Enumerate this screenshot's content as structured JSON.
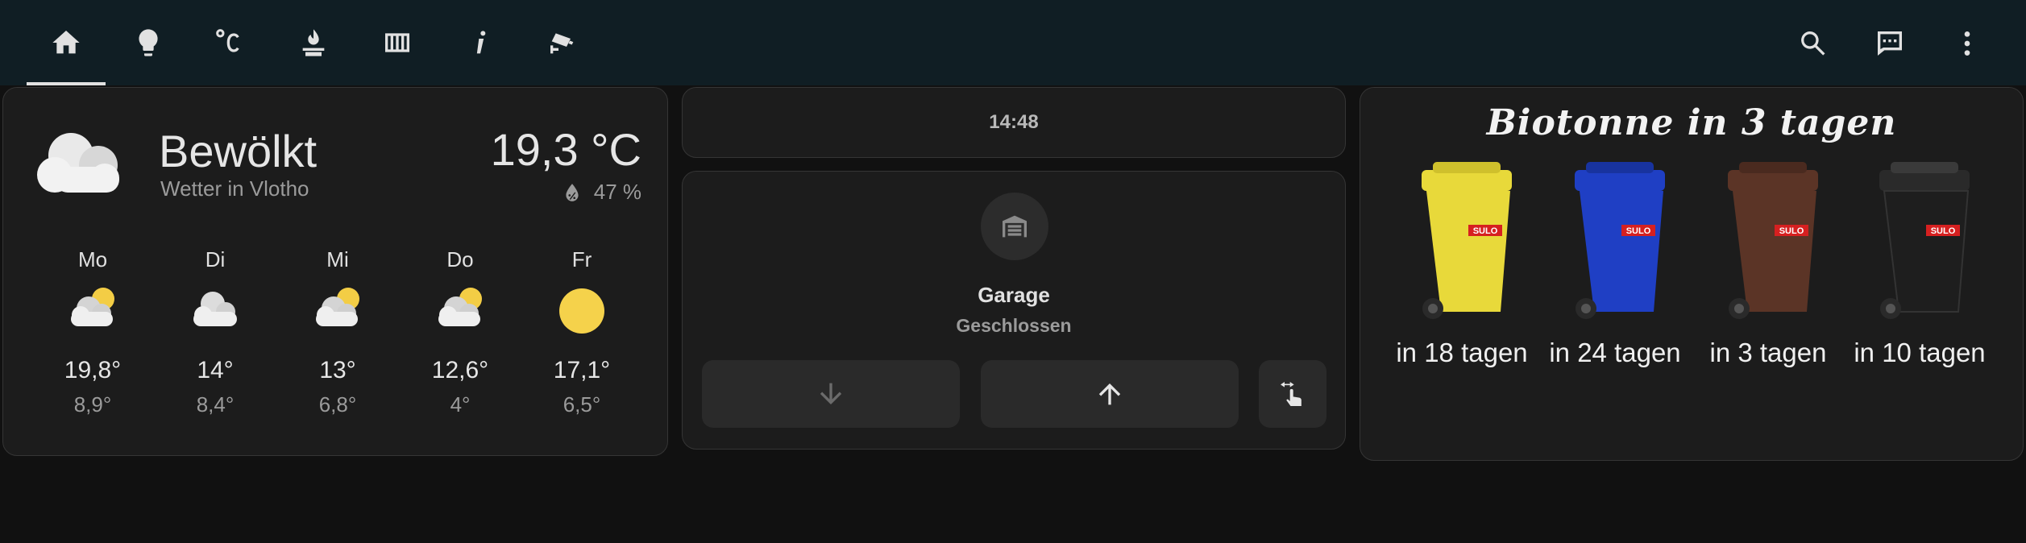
{
  "nav": {
    "tabs": [
      {
        "icon": "home-icon",
        "active": true
      },
      {
        "icon": "lightbulb-icon",
        "active": false
      },
      {
        "icon": "thermometer-celsius-icon",
        "active": false
      },
      {
        "icon": "fire-heater-icon",
        "active": false
      },
      {
        "icon": "radiator-icon",
        "active": false
      },
      {
        "icon": "info-icon",
        "active": false
      },
      {
        "icon": "cctv-camera-icon",
        "active": false
      }
    ],
    "actions": [
      "search-icon",
      "assist-chat-icon",
      "more-menu-icon"
    ]
  },
  "weather": {
    "condition": "Bewölkt",
    "location": "Wetter in Vlotho",
    "temperature": "19,3 °C",
    "humidity": "47 %",
    "forecast": [
      {
        "day": "Mo",
        "icon": "partly-cloudy-icon",
        "high": "19,8°",
        "low": "8,9°"
      },
      {
        "day": "Di",
        "icon": "cloudy-icon",
        "high": "14°",
        "low": "8,4°"
      },
      {
        "day": "Mi",
        "icon": "partly-cloudy-icon",
        "high": "13°",
        "low": "6,8°"
      },
      {
        "day": "Do",
        "icon": "partly-cloudy-icon",
        "high": "12,6°",
        "low": "4°"
      },
      {
        "day": "Fr",
        "icon": "sunny-icon",
        "high": "17,1°",
        "low": "6,5°"
      }
    ]
  },
  "clock": {
    "time": "14:48"
  },
  "garage": {
    "name": "Garage",
    "state": "Geschlossen"
  },
  "bins": {
    "title": "Biotonne in 3 tagen",
    "items": [
      {
        "color": "#e8d93a",
        "label": "in 18 tagen",
        "brand": "SULO"
      },
      {
        "color": "#1f3fc4",
        "label": "in 24 tagen",
        "brand": "SULO"
      },
      {
        "color": "#5b3426",
        "label": "in 3 tagen",
        "brand": "SULO"
      },
      {
        "color": "#1e1e1e",
        "label": "in 10 tagen",
        "brand": "SULO"
      }
    ]
  }
}
